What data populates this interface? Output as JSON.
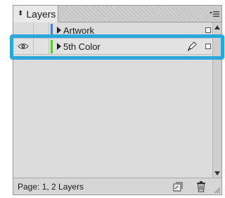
{
  "panel": {
    "tab_title": "Layers",
    "tab_icon": "up-down-arrows-icon",
    "menu_icon": "panel-menu-icon"
  },
  "layers": [
    {
      "name": "Artwork",
      "color": "#4a7fd8",
      "visible": false,
      "selected": false,
      "pen": false
    },
    {
      "name": "5th Color",
      "color": "#5cc63a",
      "visible": true,
      "selected": true,
      "pen": true
    }
  ],
  "status": {
    "text": "Page: 1, 2 Layers"
  },
  "colors": {
    "highlight": "#2aa8dc",
    "panel_bg": "#d8d8d8"
  }
}
